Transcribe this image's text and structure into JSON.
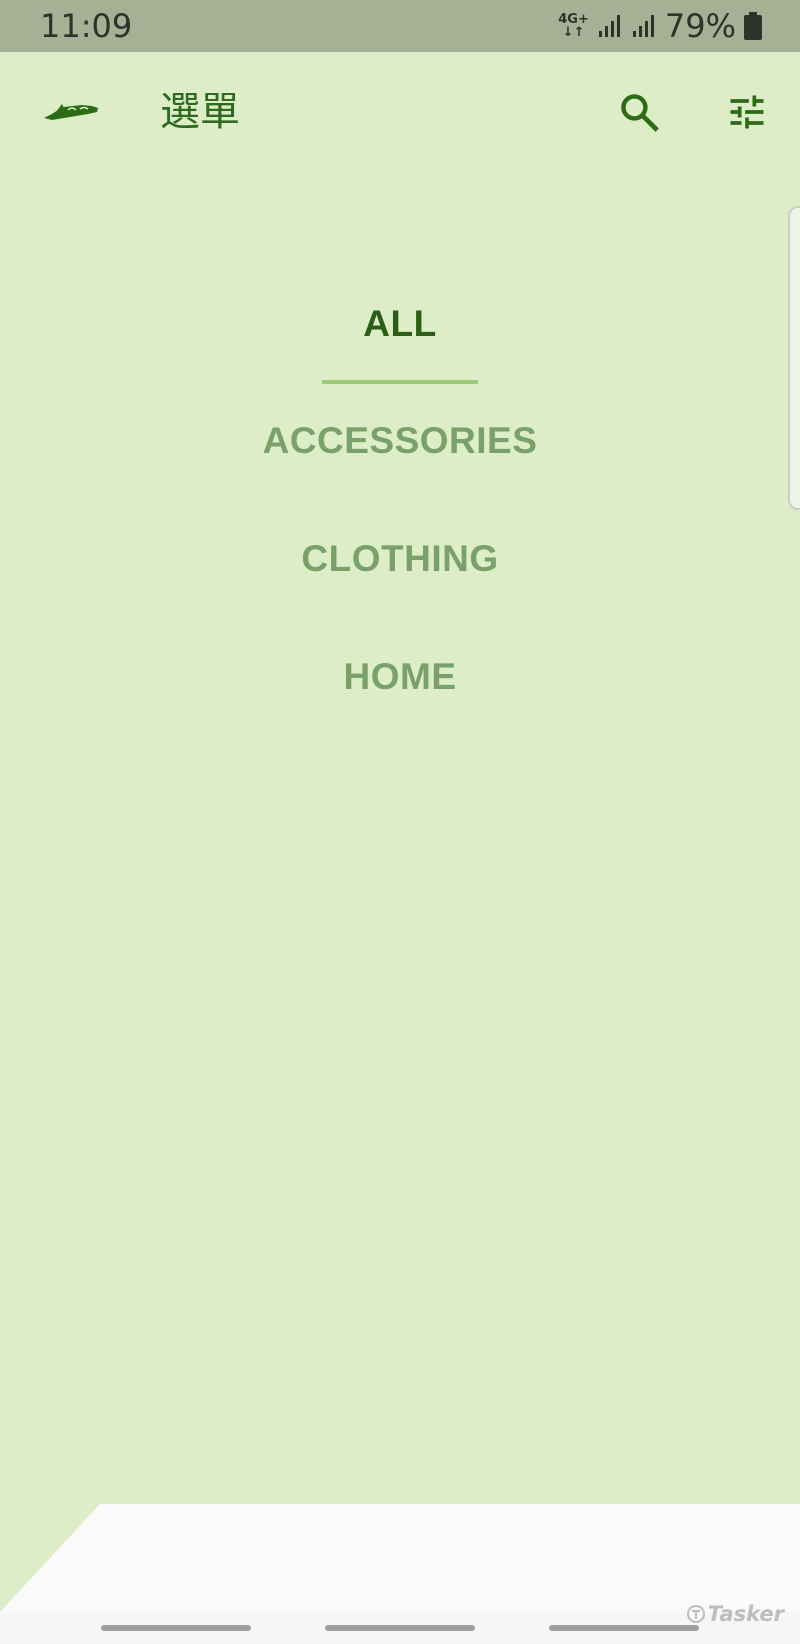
{
  "status_bar": {
    "time": "11:09",
    "network_type_top": "4G+",
    "network_arrows": "↓↑",
    "battery_percent": "79%",
    "icons": [
      "signal-icon",
      "signal-icon",
      "battery-icon"
    ]
  },
  "app_bar": {
    "logo_icon": "brand-logo",
    "title": "選單",
    "search_icon": "search-icon",
    "filter_icon": "tune-icon"
  },
  "category_menu": {
    "selected": "ALL",
    "items": [
      {
        "label": "ALL",
        "active": true
      },
      {
        "label": "ACCESSORIES",
        "active": false
      },
      {
        "label": "CLOTHING",
        "active": false
      },
      {
        "label": "HOME",
        "active": false
      }
    ]
  },
  "watermark": {
    "text": "Tasker"
  },
  "colors": {
    "background": "#dcedc8",
    "status_bar": "#a5b095",
    "primary_dark": "#2d5e17",
    "inactive": "#7aa16a",
    "accent_underline": "#9bcc74",
    "sheet": "#fafafa"
  }
}
